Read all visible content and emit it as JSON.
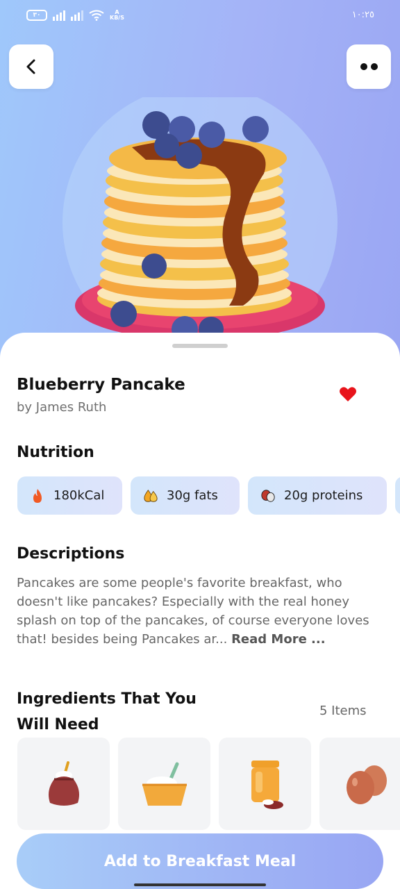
{
  "status_bar": {
    "battery_label": "٣٠",
    "network_speed_top": "A",
    "network_speed_bottom": "KB/S",
    "time": "١٠:٢٥"
  },
  "recipe": {
    "title": "Blueberry Pancake",
    "author": "by James Ruth"
  },
  "nutrition": {
    "heading": "Nutrition",
    "items": [
      {
        "icon": "flame-icon",
        "label": "180kCal"
      },
      {
        "icon": "fat-drops-icon",
        "label": "30g fats"
      },
      {
        "icon": "protein-icon",
        "label": "20g proteins"
      }
    ]
  },
  "description": {
    "heading": "Descriptions",
    "text": "Pancakes are some people's favorite breakfast, who doesn't like pancakes? Especially with the real honey splash on top of the pancakes, of course everyone loves that! besides being Pancakes ar... ",
    "read_more": "Read More ..."
  },
  "ingredients": {
    "heading": "Ingredients That You Will Need",
    "count": "5 Items",
    "items": [
      {
        "icon": "flour-sack-icon"
      },
      {
        "icon": "sugar-bowl-icon"
      },
      {
        "icon": "honey-jar-icon"
      },
      {
        "icon": "eggs-icon"
      }
    ]
  },
  "cta": {
    "label": "Add to Breakfast Meal"
  },
  "colors": {
    "hero_gradient_start": "#9fc8fb",
    "hero_gradient_end": "#9aa6f3",
    "chip_bg": "#d9e5fb",
    "heart": "#e8141b"
  }
}
